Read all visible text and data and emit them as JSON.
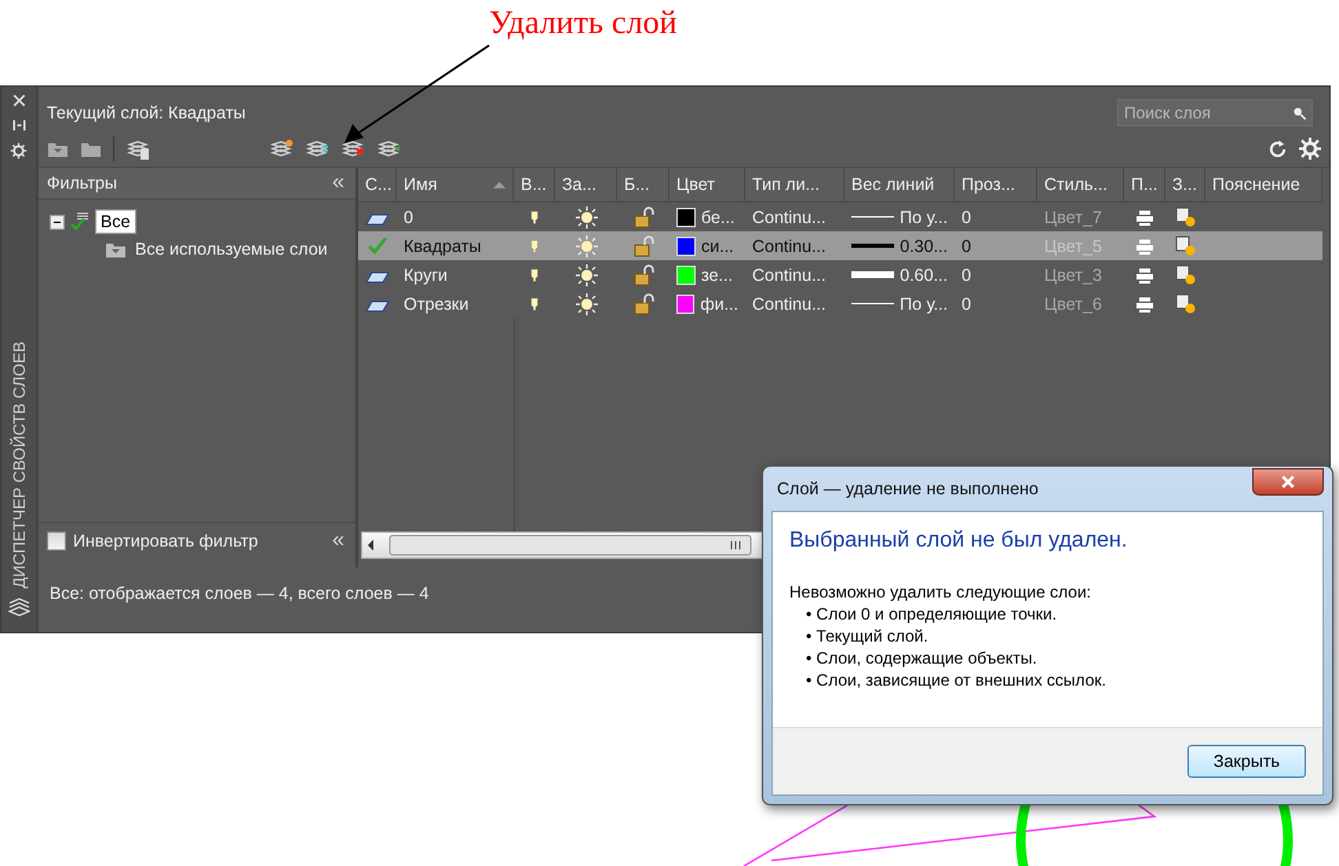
{
  "annotation": {
    "text": "Удалить слой"
  },
  "side_strip": {
    "title": "ДИСПЕТЧЕР СВОЙСТВ СЛОЕВ"
  },
  "header": {
    "current_layer": "Текущий слой: Квадраты",
    "search": {
      "placeholder": "Поиск слоя"
    }
  },
  "filters": {
    "title": "Фильтры",
    "collapse": "«",
    "collapse_bottom": "«",
    "tree": [
      {
        "label": "Все",
        "selected": true,
        "expanded": true,
        "children": [
          {
            "label": "Все используемые слои",
            "selected": false
          }
        ]
      }
    ],
    "invert": {
      "label": "Инвертировать фильтр",
      "checked": false
    }
  },
  "table": {
    "columns": [
      {
        "label": "С...",
        "sorted": false
      },
      {
        "label": "Имя",
        "sorted": true
      },
      {
        "label": "В...",
        "sorted": false
      },
      {
        "label": "За...",
        "sorted": false
      },
      {
        "label": "Б...",
        "sorted": false
      },
      {
        "label": "Цвет",
        "sorted": false
      },
      {
        "label": "Тип ли...",
        "sorted": false
      },
      {
        "label": "Вес линий",
        "sorted": false
      },
      {
        "label": "Проз...",
        "sorted": false
      },
      {
        "label": "Стиль...",
        "sorted": false
      },
      {
        "label": "П...",
        "sorted": false
      },
      {
        "label": "З...",
        "sorted": false
      },
      {
        "label": "Пояснение",
        "sorted": false
      }
    ],
    "rows": [
      {
        "kind": "layer",
        "name": "0",
        "selected": false,
        "on": true,
        "frozen": false,
        "locked": false,
        "color": "#000000",
        "color_name": "бе...",
        "linetype": "Continu...",
        "line_sample": {
          "kind": "default"
        },
        "lineweight": "По у...",
        "transparency": "0",
        "plot_style": "Цвет_7"
      },
      {
        "kind": "current",
        "name": "Квадраты",
        "selected": true,
        "on": true,
        "frozen": false,
        "locked": false,
        "color": "#0000ff",
        "color_name": "си...",
        "linetype": "Continu...",
        "line_sample": {
          "kind": "medium"
        },
        "lineweight": "0.30...",
        "transparency": "0",
        "plot_style": "Цвет_5"
      },
      {
        "kind": "layer",
        "name": "Круги",
        "selected": false,
        "on": true,
        "frozen": false,
        "locked": false,
        "color": "#00ff00",
        "color_name": "зе...",
        "linetype": "Continu...",
        "line_sample": {
          "kind": "heavy"
        },
        "lineweight": "0.60...",
        "transparency": "0",
        "plot_style": "Цвет_3"
      },
      {
        "kind": "layer",
        "name": "Отрезки",
        "selected": false,
        "on": true,
        "frozen": false,
        "locked": false,
        "color": "#ff00ff",
        "color_name": "фи...",
        "linetype": "Continu...",
        "line_sample": {
          "kind": "default"
        },
        "lineweight": "По у...",
        "transparency": "0",
        "plot_style": "Цвет_6"
      }
    ]
  },
  "status_bar": "Все: отображается слоев — 4, всего слоев — 4",
  "dialog": {
    "title": "Слой — удаление не выполнено",
    "heading": "Выбранный слой не был удален.",
    "intro": "Невозможно удалить следующие слои:",
    "items": [
      "• Слои 0 и определяющие точки.",
      "• Текущий слой.",
      "• Слои, содержащие объекты.",
      "• Слои, зависящие от внешних ссылок."
    ],
    "button": "Закрыть"
  }
}
